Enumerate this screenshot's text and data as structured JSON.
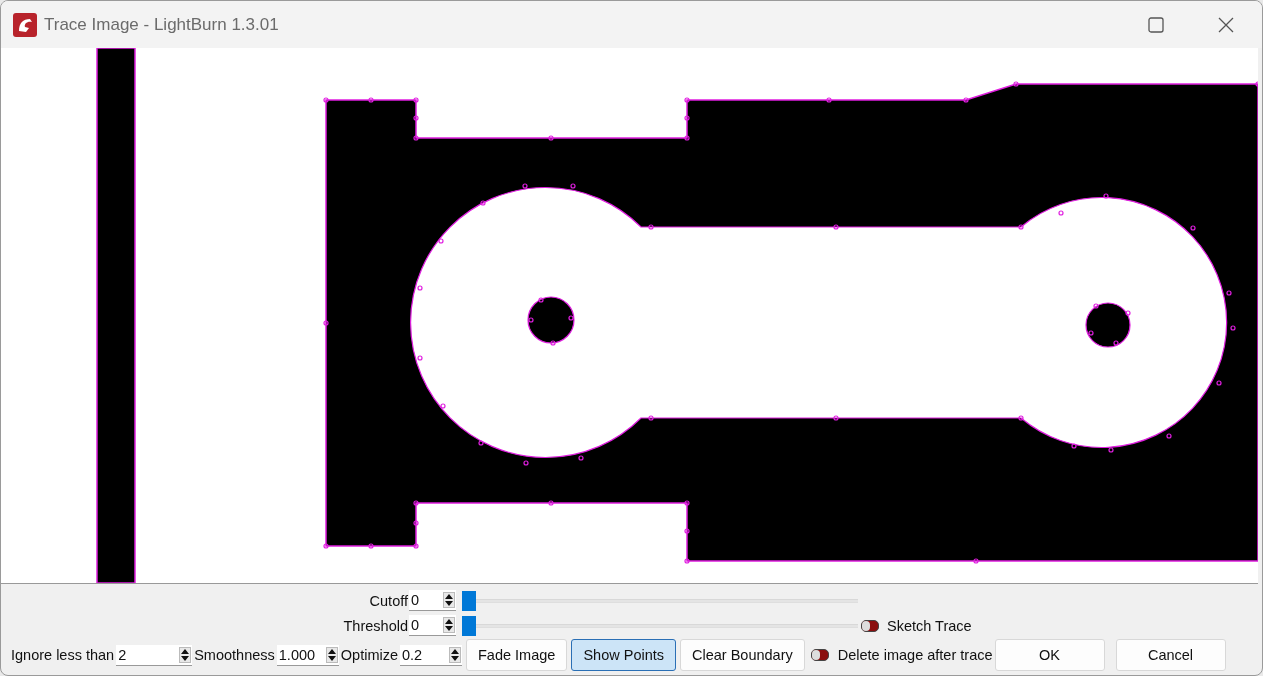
{
  "window": {
    "title": "Trace Image - LightBurn 1.3.01"
  },
  "sliders": [
    {
      "label": "Cutoff",
      "value": "0",
      "level": 0
    },
    {
      "label": "Threshold",
      "value": "0",
      "level": 0
    }
  ],
  "sketch_trace": {
    "label": "Sketch Trace",
    "on": false
  },
  "options": [
    {
      "label": "Ignore less than",
      "value": "2"
    },
    {
      "label": "Smoothness",
      "value": "1.000"
    },
    {
      "label": "Optimize",
      "value": "0.2"
    }
  ],
  "toggle_buttons": [
    {
      "label": "Fade Image",
      "selected": false
    },
    {
      "label": "Show Points",
      "selected": true
    },
    {
      "label": "Clear Boundary",
      "selected": false
    }
  ],
  "delete_after": {
    "label": "Delete image after trace",
    "on": false
  },
  "buttons": [
    "OK",
    "Cancel"
  ]
}
